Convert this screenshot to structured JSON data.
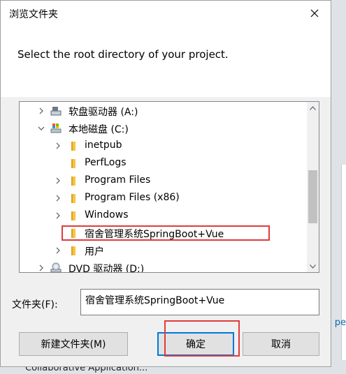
{
  "dialog": {
    "title": "浏览文件夹",
    "prompt": "Select the root directory of your project.",
    "folder_label": "文件夹(F):",
    "folder_value": "宿舍管理系统SpringBoot+Vue"
  },
  "tree": {
    "items": [
      {
        "label": "软盘驱动器 (A:)",
        "icon": "floppy-drive-icon",
        "expand": "collapsed"
      },
      {
        "label": "本地磁盘 (C:)",
        "icon": "local-disk-icon",
        "expand": "expanded"
      },
      {
        "label": "inetpub",
        "icon": "folder-icon",
        "expand": "collapsed"
      },
      {
        "label": "PerfLogs",
        "icon": "folder-icon",
        "expand": "none"
      },
      {
        "label": "Program Files",
        "icon": "folder-icon",
        "expand": "collapsed"
      },
      {
        "label": "Program Files (x86)",
        "icon": "folder-icon",
        "expand": "collapsed"
      },
      {
        "label": "Windows",
        "icon": "folder-icon",
        "expand": "collapsed"
      },
      {
        "label": "宿舍管理系统SpringBoot+Vue",
        "icon": "folder-icon",
        "expand": "none",
        "selected": true
      },
      {
        "label": "用户",
        "icon": "folder-icon",
        "expand": "collapsed"
      },
      {
        "label": "DVD 驱动器 (D:)",
        "icon": "dvd-drive-icon",
        "expand": "collapsed"
      }
    ]
  },
  "buttons": {
    "new_folder": "新建文件夹(M)",
    "ok": "确定",
    "cancel": "取消"
  },
  "background": {
    "snippet": "pe",
    "footer": "Collaborative Application..."
  },
  "colors": {
    "highlight_red": "#e03b3b",
    "focus_blue": "#0078d7",
    "folder_yellow": "#f5c542"
  }
}
